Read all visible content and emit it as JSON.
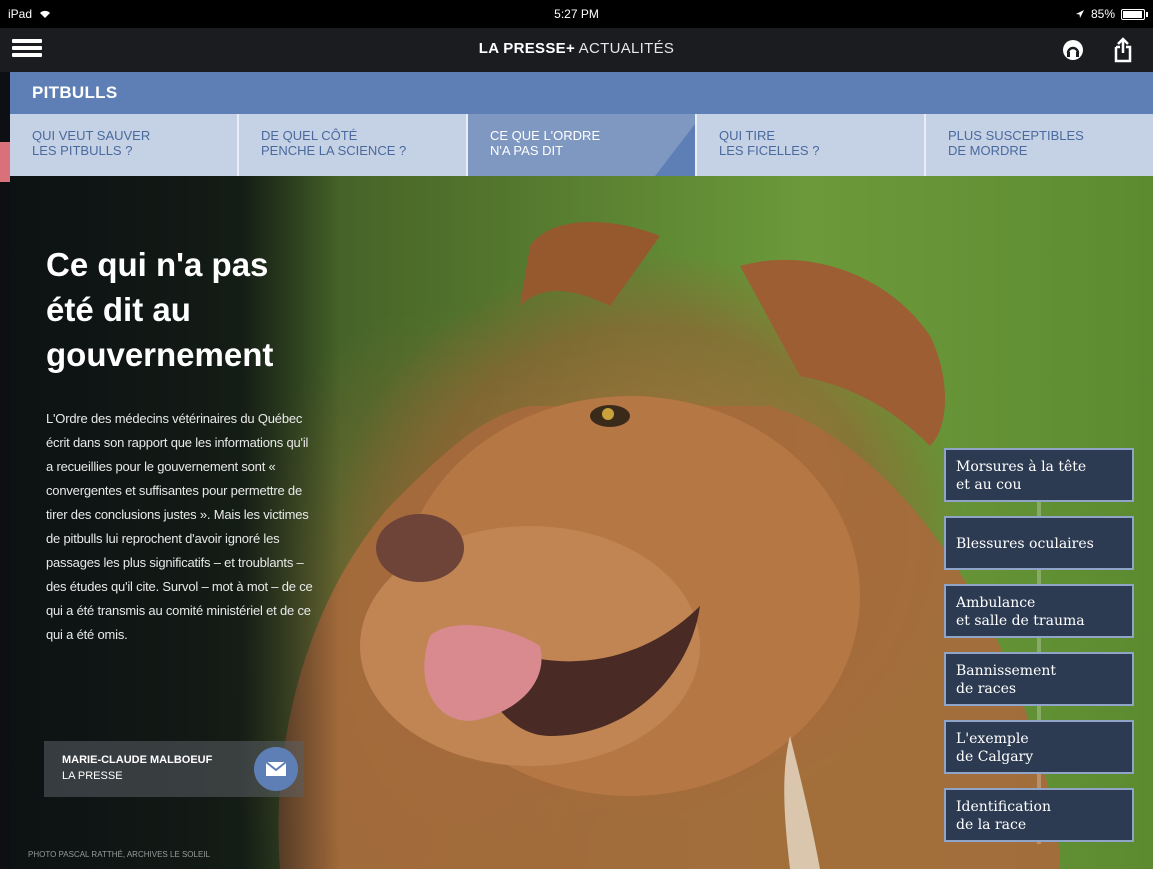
{
  "status_bar": {
    "device": "iPad",
    "time": "5:27 PM",
    "battery": "85%"
  },
  "app_header": {
    "brand_bold": "LA PRESSE+",
    "brand_light": " ACTUALITÉS"
  },
  "section": {
    "title": "PITBULLS"
  },
  "tabs": [
    {
      "line1": "QUI VEUT SAUVER",
      "line2": "LES PITBULLS ?"
    },
    {
      "line1": "DE QUEL CÔTÉ",
      "line2": "PENCHE LA SCIENCE ?"
    },
    {
      "line1": "CE QUE L'ORDRE",
      "line2": "N'A PAS DIT"
    },
    {
      "line1": "QUI TIRE",
      "line2": "LES FICELLES ?"
    },
    {
      "line1": "PLUS SUSCEPTIBLES",
      "line2": "DE MORDRE"
    }
  ],
  "article": {
    "title": "Ce qui n'a pas été dit au gouvernement",
    "body": "L'Ordre des médecins vétérinaires du Québec écrit dans son rapport que les informations qu'il a recueillies pour le gouvernement sont « convergentes et suffisantes pour permettre de tirer des conclusions justes ». Mais les victimes de pitbulls lui reprochent d'avoir ignoré les passages les plus significatifs – et troublants – des études qu'il cite. Survol – mot à mot – de ce qui a été transmis au comité ministériel et de ce qui a été omis.",
    "author_name": "MARIE-CLAUDE MALBOEUF",
    "author_outlet": "LA PRESSE",
    "photo_credit": "PHOTO PASCAL RATTHÉ, ARCHIVES LE SOLEIL"
  },
  "topics": [
    {
      "line1": "Morsures à la tête",
      "line2": "et au cou"
    },
    {
      "line1": "Blessures oculaires",
      "line2": ""
    },
    {
      "line1": "Ambulance",
      "line2": "et salle de trauma"
    },
    {
      "line1": "Bannissement",
      "line2": "de races"
    },
    {
      "line1": "L'exemple",
      "line2": "de Calgary"
    },
    {
      "line1": "Identification",
      "line2": "de la race"
    }
  ],
  "colors": {
    "section_bar": "#5e7fb5",
    "tab_bg": "#c5d1e4",
    "tab_active": "#7f98c2",
    "topic_bg": "#2d3b52",
    "topic_border": "#8fa4c6"
  }
}
